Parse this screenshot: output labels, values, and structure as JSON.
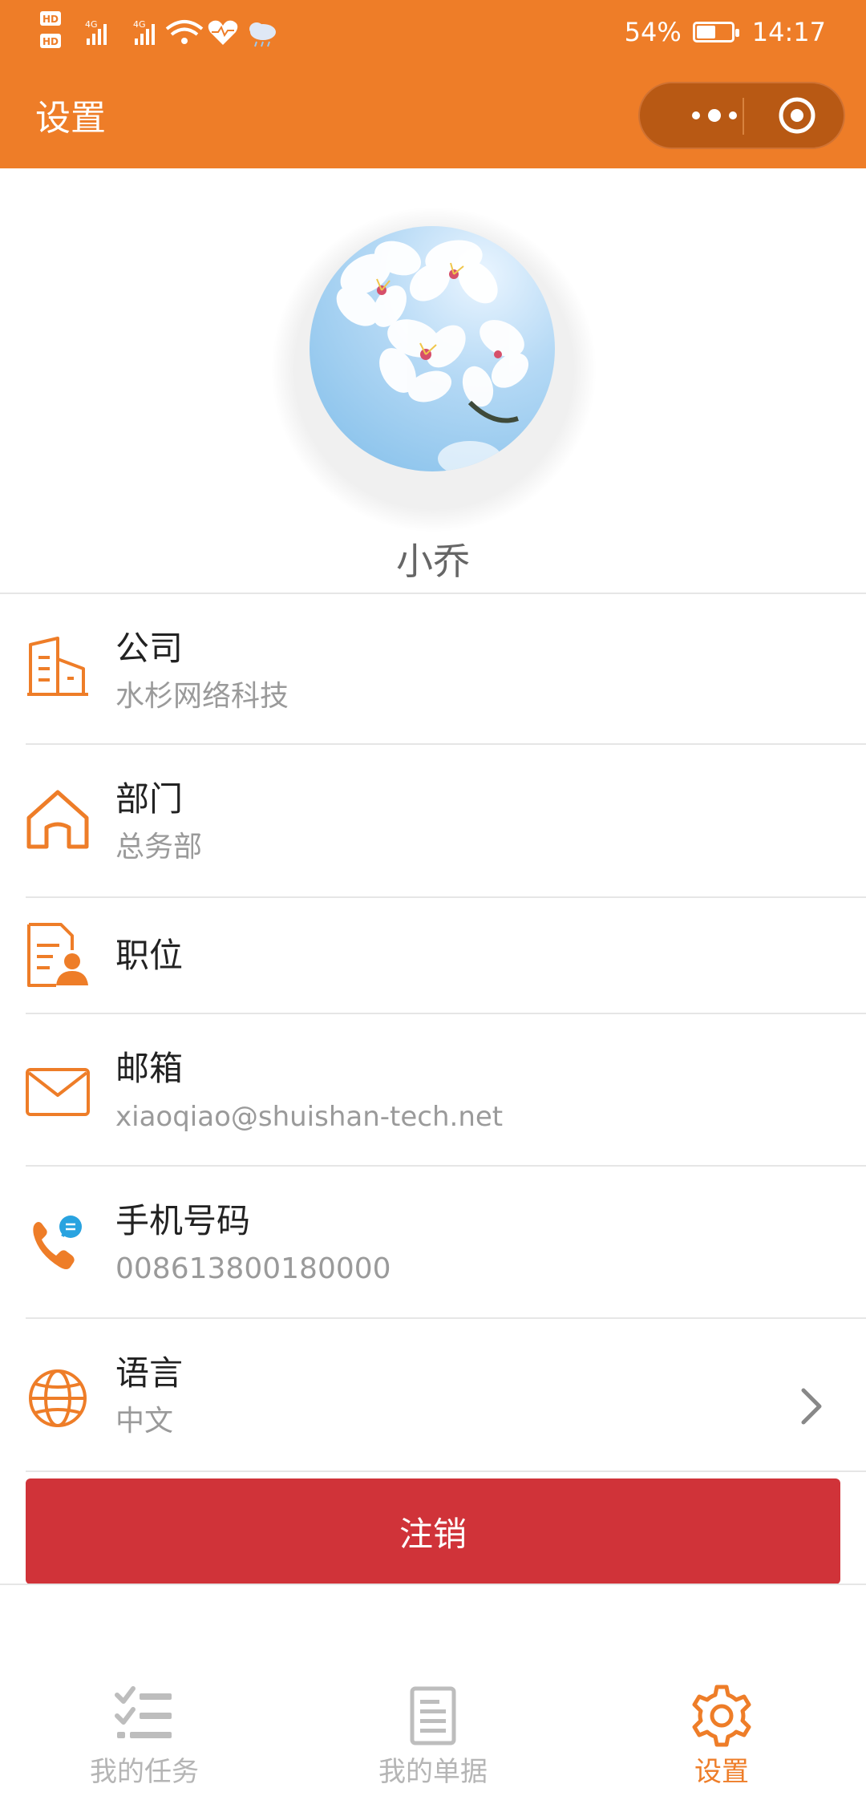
{
  "status_bar": {
    "battery": "54%",
    "battery_level": 0.54,
    "time": "14:17",
    "sim1": "HD",
    "sim2": "HD",
    "net1": "4G",
    "net2": "4G"
  },
  "nav": {
    "title": "设置"
  },
  "profile": {
    "name": "小乔"
  },
  "rows": [
    {
      "icon": "building-icon",
      "title": "公司",
      "value": "水杉网络科技"
    },
    {
      "icon": "house-icon",
      "title": "部门",
      "value": "总务部"
    },
    {
      "icon": "id-card-icon",
      "title": "职位",
      "value": ""
    },
    {
      "icon": "mail-icon",
      "title": "邮箱",
      "value": "xiaoqiao@shuishan-tech.net"
    },
    {
      "icon": "phone-icon",
      "title": "手机号码",
      "value": "008613800180000"
    },
    {
      "icon": "globe-icon",
      "title": "语言",
      "value": "中文"
    }
  ],
  "logout_label": "注销",
  "tabs": [
    {
      "label": "我的任务",
      "icon": "task-list-icon",
      "active": false
    },
    {
      "label": "我的单据",
      "icon": "document-icon",
      "active": false
    },
    {
      "label": "设置",
      "icon": "gear-icon",
      "active": true
    }
  ],
  "colors": {
    "brand": "#ee7d28",
    "danger": "#d03339",
    "tab_inactive": "#b5b5b5",
    "tab_active": "#ee7d28"
  }
}
